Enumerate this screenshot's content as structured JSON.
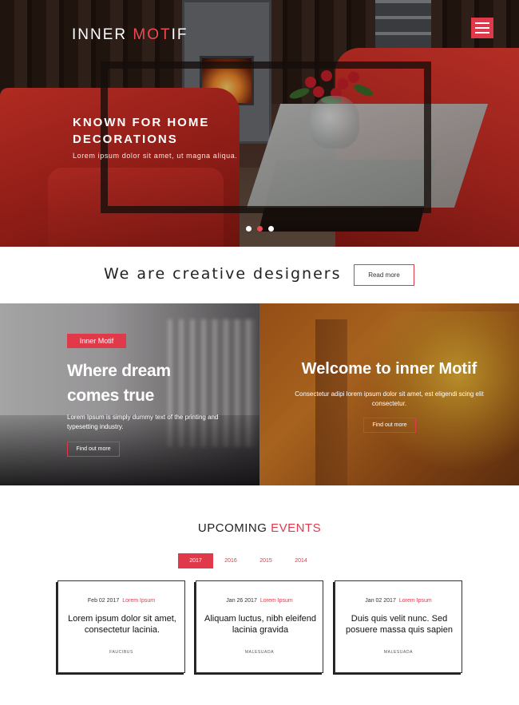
{
  "brand": {
    "part1": "INNER ",
    "part2": "MOT",
    "part3": "IF"
  },
  "hero": {
    "title": "KNOWN FOR HOME DECORATIONS",
    "subtitle": "Lorem ipsum dolor sit amet, ut magna aliqua.",
    "slides": 3,
    "active_slide": 2
  },
  "tagline": {
    "text": "We are creative designers",
    "button": "Read more"
  },
  "promo_left": {
    "badge_part1": "I",
    "badge_part2": "nner ",
    "badge_part3": "M",
    "badge_part4": "otif",
    "title": "Where dream comes true",
    "text": "Lorem Ipsum is simply dummy text of the printing and typesetting industry.",
    "button": "Find out more"
  },
  "promo_right": {
    "title": "Welcome to inner Motif",
    "text": "Consectetur adipi lorem ipsum dolor sit amet, est eligendi scing elit consectetur.",
    "button": "Find out more"
  },
  "events": {
    "title_part1": "UPCOMING ",
    "title_part2": "EVENTS",
    "years": [
      "2017",
      "2016",
      "2015",
      "2014"
    ],
    "active_year": "2017",
    "cards": [
      {
        "date": "Feb 02 2017",
        "category": "Lorem Ipsum",
        "title": "Lorem ipsum dolor sit amet, consectetur lacinia.",
        "tag": "FAUCIBUS"
      },
      {
        "date": "Jan 26 2017",
        "category": "Lorem Ipsum",
        "title": "Aliquam luctus, nibh eleifend lacinia gravida",
        "tag": "MALESUADA"
      },
      {
        "date": "Jan 02 2017",
        "category": "Lorem Ipsum",
        "title": "Duis quis velit nunc. Sed posuere massa quis sapien",
        "tag": "MALESUADA"
      }
    ]
  },
  "colors": {
    "accent": "#e0394a"
  },
  "icons": {
    "menu": "hamburger-menu-icon"
  }
}
